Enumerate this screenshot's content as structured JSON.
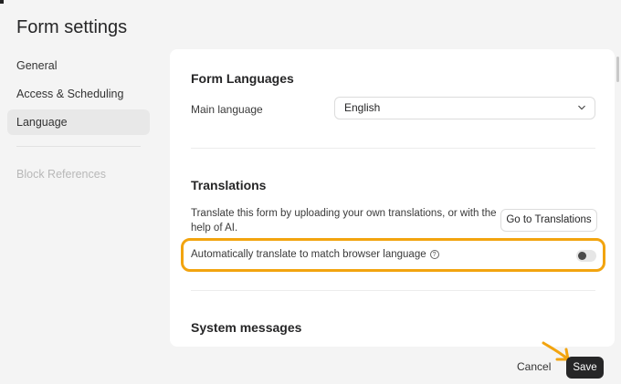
{
  "page": {
    "title": "Form settings"
  },
  "sidebar": {
    "items": [
      {
        "label": "General"
      },
      {
        "label": "Access & Scheduling"
      },
      {
        "label": "Language"
      },
      {
        "label": "Block References"
      }
    ]
  },
  "languages": {
    "heading": "Form Languages",
    "main_language_label": "Main language",
    "main_language_value": "English"
  },
  "translations": {
    "heading": "Translations",
    "description": "Translate this form by uploading your own translations, or with the help of AI.",
    "goto_button": "Go to Translations",
    "auto_translate_label": "Automatically translate to match browser language",
    "auto_translate_on": false
  },
  "system": {
    "heading": "System messages"
  },
  "footer": {
    "cancel": "Cancel",
    "save": "Save"
  },
  "colors": {
    "highlight": "#f2a40f",
    "primary_button": "#262627"
  }
}
